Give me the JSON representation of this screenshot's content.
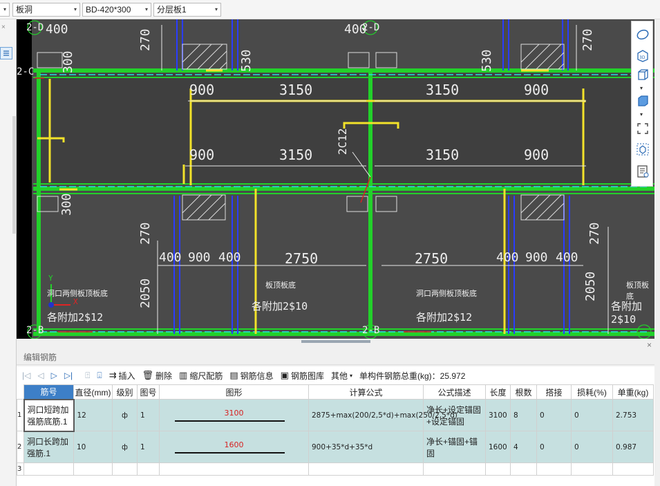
{
  "toolbar_top": {
    "combo1": "板洞",
    "combo2": "BD-420*300",
    "combo3": "分层板1"
  },
  "cad": {
    "dims": [
      "400",
      "400",
      "270",
      "270",
      "530",
      "530",
      "300",
      "300",
      "900",
      "3150",
      "3150",
      "900",
      "900",
      "3150",
      "3150",
      "900",
      "400",
      "900",
      "400",
      "400",
      "900",
      "400",
      "2750",
      "2750",
      "2050",
      "2050",
      "270",
      "270"
    ],
    "rebar_label": "2C12",
    "grid_labels": [
      "2-D",
      "2-D",
      "2-C",
      "2-B",
      "2-B"
    ],
    "notes": [
      "洞口两侧板顶板底",
      "板顶板底",
      "洞口两侧板顶板底",
      "板顶板底"
    ],
    "bar_notes": [
      "各附加2$12",
      "各附加2$10",
      "各附加2$12",
      "各附加2$10"
    ],
    "axis_x": "X",
    "axis_y": "Y"
  },
  "panel": {
    "title": "编辑钢筋",
    "close": "×"
  },
  "toolbar": {
    "insert": "插入",
    "delete": "删除",
    "scale": "缩尺配筋",
    "info": "钢筋信息",
    "library": "钢筋图库",
    "other": "其他",
    "total": "单构件钢筋总重(kg)：25.972"
  },
  "table": {
    "headers": [
      "筋号",
      "直径(mm)",
      "级别",
      "图号",
      "图形",
      "计算公式",
      "公式描述",
      "长度",
      "根数",
      "搭接",
      "损耗(%)",
      "单重(kg)"
    ],
    "rows": [
      {
        "num": "1",
        "name": "洞口短跨加强筋底筋.1",
        "dia": "12",
        "grade": "ф",
        "fig": "1",
        "shape": "3100",
        "formula": "2875+max(200/2,5*d)+max(250/2,5*d)",
        "desc": "净长+设定锚固+设定锚固",
        "len": "3100",
        "count": "8",
        "lap": "0",
        "loss": "0",
        "weight": "2.753"
      },
      {
        "num": "2",
        "name": "洞口长跨加强筋.1",
        "dia": "10",
        "grade": "ф",
        "fig": "1",
        "shape": "1600",
        "formula": "900+35*d+35*d",
        "desc": "净长+锚固+锚固",
        "len": "1600",
        "count": "4",
        "lap": "0",
        "loss": "0",
        "weight": "0.987"
      }
    ],
    "row3": "3"
  }
}
